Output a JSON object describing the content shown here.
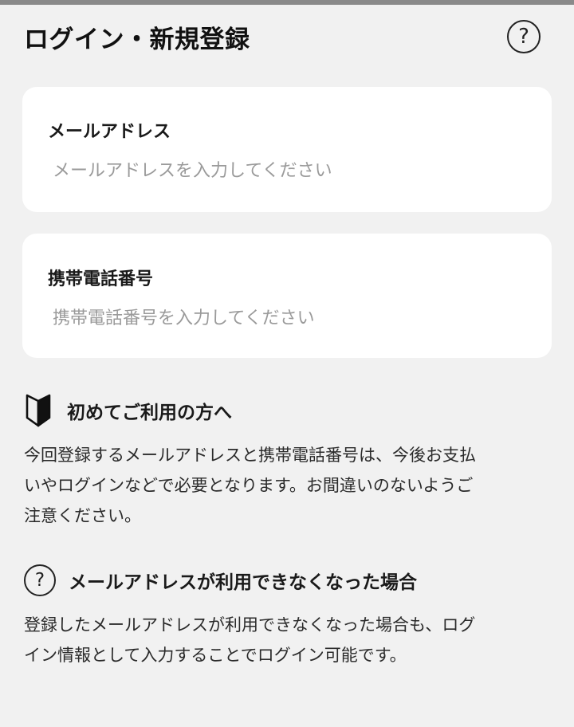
{
  "header": {
    "title": "ログイン・新規登録",
    "help_symbol": "?",
    "help_icon": "help-circle-icon"
  },
  "form": {
    "email": {
      "label": "メールアドレス",
      "value": "",
      "placeholder": "メールアドレスを入力してください"
    },
    "phone": {
      "label": "携帯電話番号",
      "value": "",
      "placeholder": "携帯電話番号を入力してください"
    }
  },
  "sections": {
    "beginner": {
      "icon": "beginner-mark-icon",
      "title": "初めてご利用の方へ",
      "lines": [
        "今回登録するメールアドレスと携帯電話番号は、今後お支払",
        "いやログインなどで必要となります。お間違いのないようご",
        "注意ください。"
      ]
    },
    "unavailable": {
      "icon": "question-circle-icon",
      "icon_symbol": "?",
      "title": "メールアドレスが利用できなくなった場合",
      "lines": [
        "登録したメールアドレスが利用できなくなった場合も、ログ",
        "イン情報として入力することでログイン可能です。"
      ]
    }
  },
  "colors": {
    "background": "#f1f1f1",
    "card": "#ffffff",
    "text": "#1a1a1a",
    "placeholder": "#9a9a9a",
    "top_bar": "#8a8a8a"
  }
}
